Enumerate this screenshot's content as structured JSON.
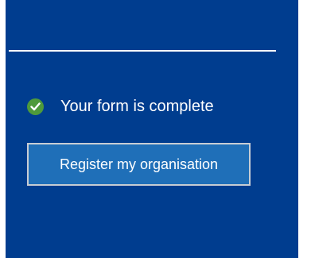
{
  "status": {
    "text": "Your form is complete",
    "icon": "check-circle-icon",
    "icon_color": "#4e9a3b"
  },
  "actions": {
    "register_label": "Register my organisation"
  },
  "colors": {
    "panel_background": "#003d8f",
    "button_background": "#1f6fb8",
    "button_border": "#c7cdd4",
    "text": "#ffffff"
  }
}
